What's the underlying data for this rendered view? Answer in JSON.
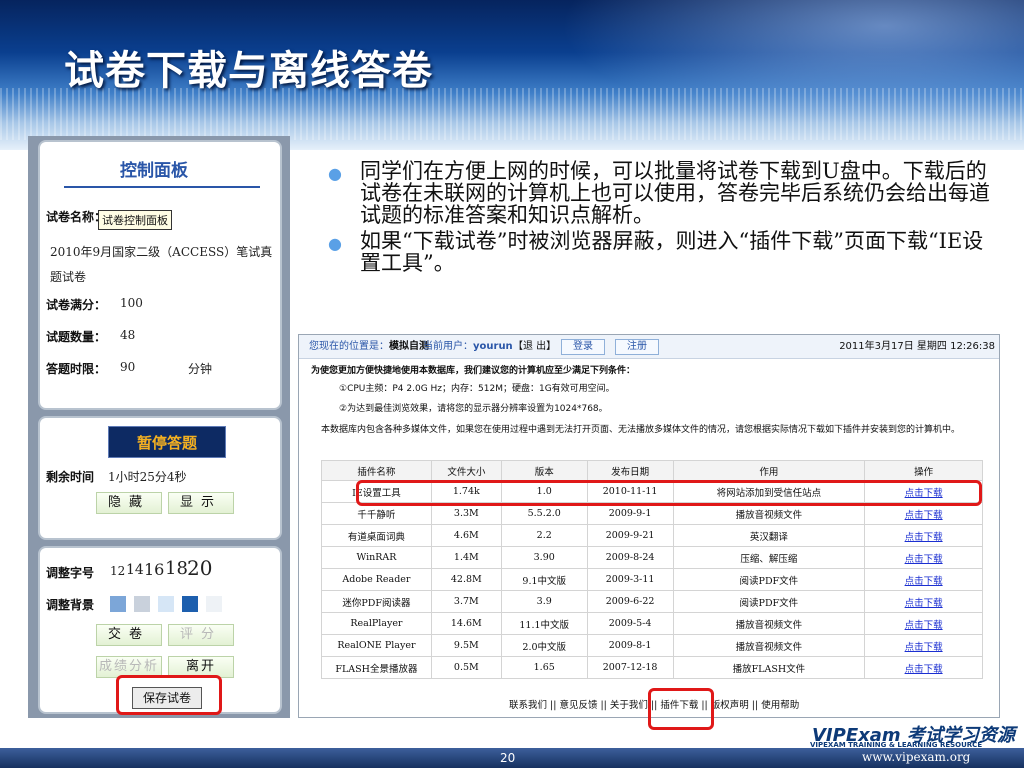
{
  "slide": {
    "title": "试卷下载与离线答卷",
    "bullets": [
      "同学们在方便上网的时候，可以批量将试卷下载到U盘中。下载后的试卷在未联网的计算机上也可以使用，答卷完毕后系统仍会给出每道试题的标准答案和知识点解析。",
      "如果“下载试卷”时被浏览器屏蔽，则进入“插件下载”页面下载“IE设置工具”。"
    ],
    "page_number": "20"
  },
  "control_panel": {
    "title": "控制面板",
    "tooltip": "试卷控制面板",
    "paper_name_label": "试卷名称：",
    "paper_name_value": "2010年9月国家二级（ACCESS）笔试真题试卷",
    "full_score_label": "试卷满分：",
    "full_score_value": "100",
    "question_count_label": "试题数量：",
    "question_count_value": "48",
    "time_limit_label": "答题时限：",
    "time_limit_value": "90",
    "time_limit_unit": "分钟",
    "pause_button": "暂停答题",
    "remaining_label": "剩余时间",
    "remaining_value": "1小时25分4秒",
    "hide_button": "隐藏",
    "show_button": "显示",
    "font_label": "调整字号",
    "font_sizes": [
      "12",
      "14",
      "16",
      "18",
      "20"
    ],
    "bg_label": "调整背景",
    "bg_colors": [
      "#7ca6d8",
      "#c9d1dc",
      "#d6e6f6",
      "#1d5fae",
      "#eef2f6"
    ],
    "submit_button": "交卷",
    "score_button": "评分",
    "analysis_button": "成绩分析",
    "leave_button": "离开",
    "save_button": "保存试卷"
  },
  "download_page": {
    "location_label": "您现在的位置是：",
    "location_value": "模拟自测",
    "user_label": "当前用户：",
    "user_value": "yourun",
    "exit_link": "【退 出】",
    "login_button": "登录",
    "register_button": "注册",
    "datetime": "2011年3月17日 星期四 12:26:38",
    "notice_heading": "为使您更加方便快捷地使用本数据库，我们建议您的计算机应至少满足下列条件：",
    "notice_1": "①CPU主频：P4 2.0G Hz；内存：512M；硬盘：1G有效可用空间。",
    "notice_2": "②为达到最佳浏览效果，请将您的显示器分辨率设置为1024*768。",
    "notice_3": "本数据库内包含各种多媒体文件，如果您在使用过程中遇到无法打开页面、无法播放多媒体文件的情况，请您根据实际情况下载如下插件并安装到您的计算机中。",
    "columns": [
      "插件名称",
      "文件大小",
      "版本",
      "发布日期",
      "作用",
      "操作"
    ],
    "rows": [
      [
        "IE设置工具",
        "1.74k",
        "1.0",
        "2010-11-11",
        "将网站添加到受信任站点",
        "点击下载"
      ],
      [
        "千千静听",
        "3.3M",
        "5.5.2.0",
        "2009-9-1",
        "播放音视频文件",
        "点击下载"
      ],
      [
        "有道桌面词典",
        "4.6M",
        "2.2",
        "2009-9-21",
        "英汉翻译",
        "点击下载"
      ],
      [
        "WinRAR",
        "1.4M",
        "3.90",
        "2009-8-24",
        "压缩、解压缩",
        "点击下载"
      ],
      [
        "Adobe Reader",
        "42.8M",
        "9.1中文版",
        "2009-3-11",
        "阅读PDF文件",
        "点击下载"
      ],
      [
        "迷你PDF阅读器",
        "3.7M",
        "3.9",
        "2009-6-22",
        "阅读PDF文件",
        "点击下载"
      ],
      [
        "RealPlayer",
        "14.6M",
        "11.1中文版",
        "2009-5-4",
        "播放音视频文件",
        "点击下载"
      ],
      [
        "RealONE Player",
        "9.5M",
        "2.0中文版",
        "2009-8-1",
        "播放音视频文件",
        "点击下载"
      ],
      [
        "FLASH全景播放器",
        "0.5M",
        "1.65",
        "2007-12-18",
        "播放FLASH文件",
        "点击下载"
      ]
    ],
    "footer_links": "联系我们 || 意见反馈 || 关于我们 || 插件下载 || 版权声明 || 使用帮助"
  },
  "brand": {
    "logo_text": "VIPExam 考试学习资源数据库",
    "logo_subtitle": "VIPEXAM TRAINING & LEARNING RESOURCE DATABASE",
    "url": "www.vipexam.org"
  }
}
